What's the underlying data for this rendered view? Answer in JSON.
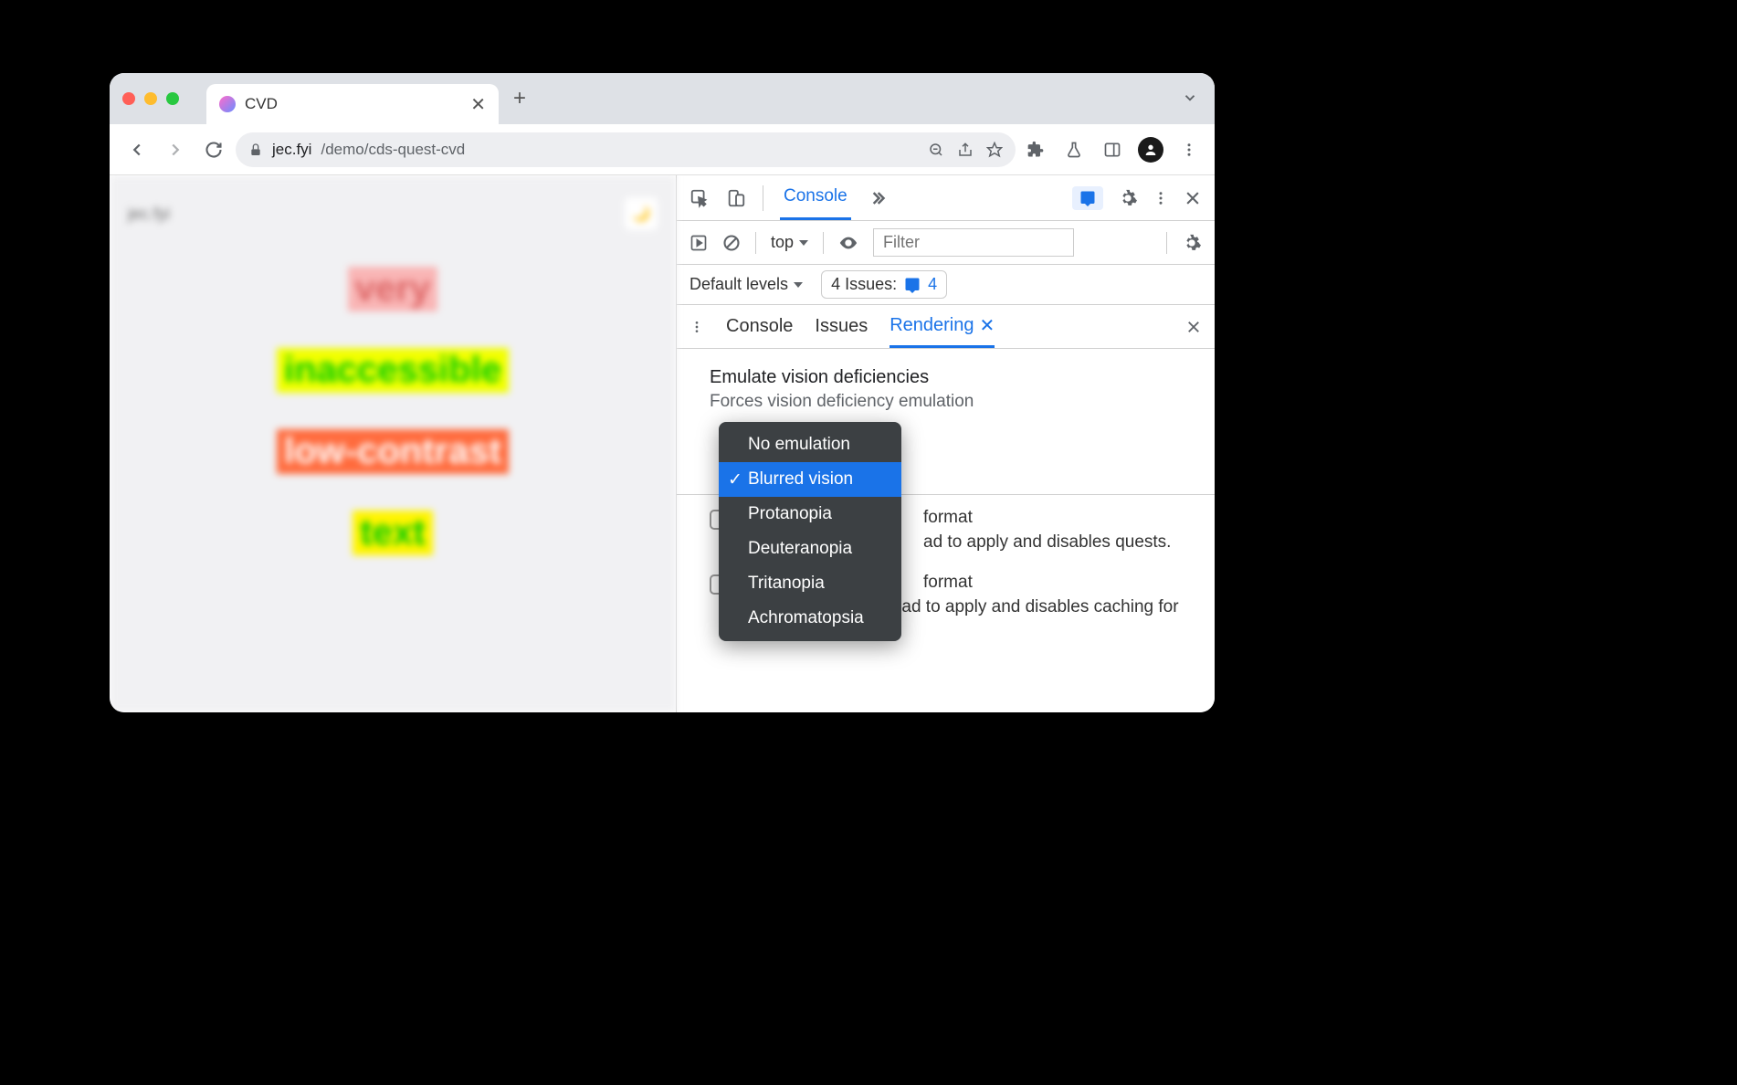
{
  "browser": {
    "tab_title": "CVD",
    "url_host": "jec.fyi",
    "url_path": "/demo/cds-quest-cvd"
  },
  "page": {
    "brand": "jec.fyi",
    "words": [
      "very",
      "inaccessible",
      "low-contrast",
      "text"
    ]
  },
  "devtools": {
    "main_tab": "Console",
    "filter_placeholder": "Filter",
    "context": "top",
    "levels": "Default levels",
    "issues_label": "4 Issues:",
    "issues_count": "4",
    "drawer": {
      "tabs": [
        "Console",
        "Issues",
        "Rendering"
      ],
      "section_title": "Emulate vision deficiencies",
      "section_subtitle": "Forces vision deficiency emulation",
      "dropdown": [
        "No emulation",
        "Blurred vision",
        "Protanopia",
        "Deuteranopia",
        "Tritanopia",
        "Achromatopsia"
      ],
      "check1_title_suffix": "format",
      "check1_text": "ad to apply and disables quests.",
      "check2_title_suffix": "format",
      "check2_text": "Requires a page reload to apply and disables caching for image requests."
    }
  }
}
